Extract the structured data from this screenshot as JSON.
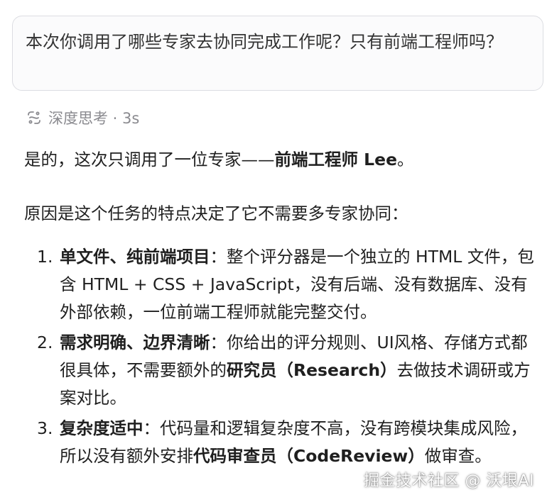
{
  "user_message": {
    "text": "本次你调用了哪些专家去协同完成工作呢？只有前端工程师吗？"
  },
  "thinking": {
    "icon": "deep-think-icon",
    "label": "深度思考 · 3s"
  },
  "answer": {
    "intro_prefix": "是的，这次只调用了一位专家——",
    "intro_bold": "前端工程师 Lee",
    "intro_suffix": "。",
    "reason_lead": "原因是这个任务的特点决定了它不需要多专家协同：",
    "reasons": [
      {
        "num": "1.",
        "title": "单文件、纯前端项目",
        "text_before": "：整个评分器是一个独立的 HTML 文件，包含 HTML + CSS + JavaScript，没有后端、没有数据库、没有外部依赖，一位前端工程师就能完整交付。",
        "bold_mid": "",
        "text_after": ""
      },
      {
        "num": "2.",
        "title": "需求明确、边界清晰",
        "text_before": "：你给出的评分规则、UI风格、存储方式都很具体，不需要额外的",
        "bold_mid": "研究员（Research）",
        "text_after": "去做技术调研或方案对比。"
      },
      {
        "num": "3.",
        "title": "复杂度适中",
        "text_before": "：代码量和逻辑复杂度不高，没有跨模块集成风险，所以没有额外安排",
        "bold_mid": "代码审查员（CodeReview）",
        "text_after": "做审查。"
      }
    ]
  },
  "watermark": {
    "text": "掘金技术社区 @ 沃垠AI"
  },
  "colors": {
    "bubble_border": "#dcdde2",
    "bubble_bg": "#fbfbfc",
    "muted": "#8a8a8f",
    "text": "#1f1f1f"
  }
}
